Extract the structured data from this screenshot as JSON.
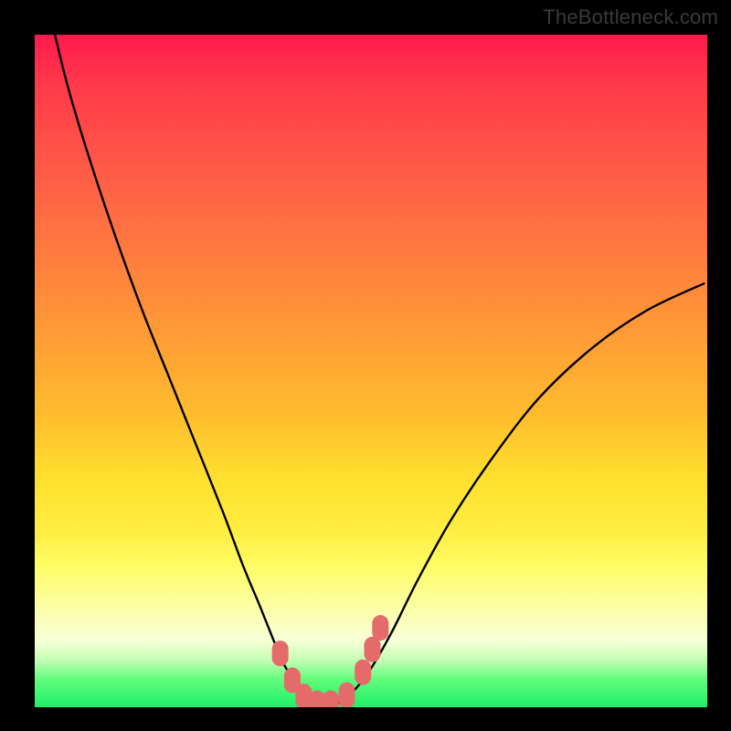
{
  "watermark": "TheBottleneck.com",
  "chart_data": {
    "type": "line",
    "title": "",
    "xlabel": "",
    "ylabel": "",
    "xlim": [
      0,
      100
    ],
    "ylim": [
      0,
      100
    ],
    "series": [
      {
        "name": "bottleneck-curve",
        "x": [
          3.0,
          5.0,
          8.0,
          12.0,
          16.0,
          20.0,
          24.0,
          28.0,
          31.0,
          33.5,
          35.5,
          37.0,
          38.5,
          40.0,
          42.0,
          44.0,
          45.5,
          47.0,
          49.5,
          53.0,
          57.0,
          62.0,
          68.0,
          75.0,
          83.0,
          91.0,
          99.5
        ],
        "y": [
          100.0,
          92.0,
          82.0,
          70.0,
          59.0,
          49.0,
          39.0,
          29.0,
          21.0,
          15.0,
          10.0,
          6.5,
          4.0,
          2.0,
          0.8,
          0.3,
          0.8,
          2.0,
          5.0,
          11.0,
          19.0,
          28.0,
          37.0,
          46.0,
          53.5,
          59.0,
          63.0
        ]
      }
    ],
    "markers": {
      "name": "highlight-markers",
      "color": "#e56a6a",
      "x": [
        36.5,
        38.3,
        40.0,
        42.0,
        44.0,
        46.4,
        48.8,
        50.2,
        51.4
      ],
      "y": [
        8.0,
        4.0,
        1.6,
        0.6,
        0.6,
        1.8,
        5.2,
        8.6,
        11.8
      ]
    },
    "background_gradient": {
      "top": "#ff1a4d",
      "upper_mid": "#ff9a36",
      "mid": "#ffe02e",
      "lower_mid": "#fdff9a",
      "bottom": "#1ef06a"
    }
  }
}
